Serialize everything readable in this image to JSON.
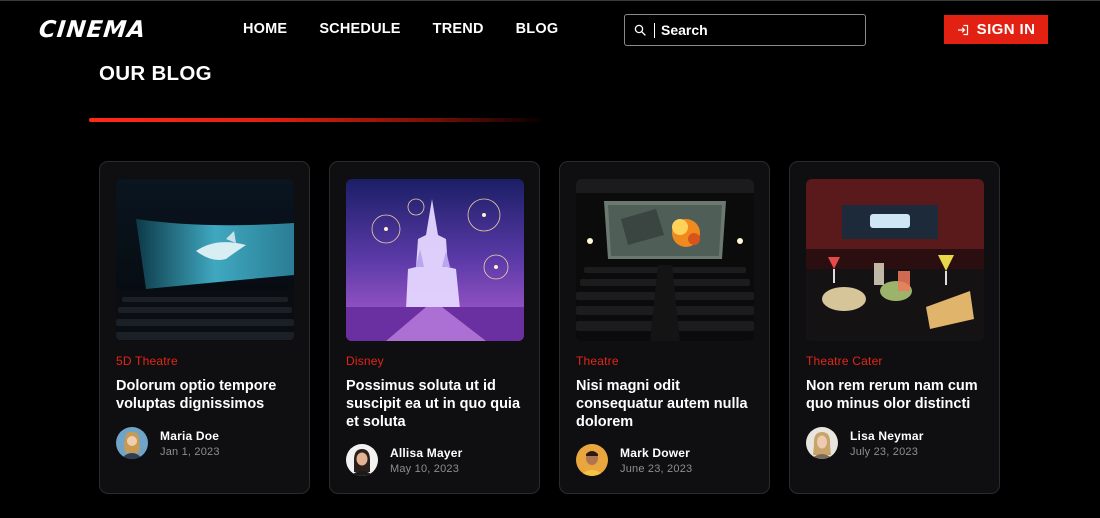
{
  "header": {
    "logo": "CINEMA",
    "nav": [
      "HOME",
      "SCHEDULE",
      "TREND",
      "BLOG"
    ],
    "search_placeholder": "Search",
    "signin_label": "SIGN IN",
    "accent_color": "#e32112"
  },
  "section": {
    "title": "OUR BLOG"
  },
  "posts": [
    {
      "category": "5D Theatre",
      "title": "Dolorum optio tempore voluptas dignissimos",
      "author": "Maria Doe",
      "date": "Jan 1, 2023",
      "image": "shark-theatre-image"
    },
    {
      "category": "Disney",
      "title": "Possimus soluta ut id suscipit ea ut in quo quia et soluta",
      "author": "Allisa Mayer",
      "date": "May 10, 2023",
      "image": "castle-fireworks-image"
    },
    {
      "category": "Theatre",
      "title": "Nisi magni odit consequatur autem nulla dolorem",
      "author": "Mark Dower",
      "date": "June 23, 2023",
      "image": "cinema-hall-image"
    },
    {
      "category": "Theatre Cater",
      "title": "Non rem rerum nam cum quo minus olor distincti",
      "author": "Lisa Neymar",
      "date": "July 23, 2023",
      "image": "dine-in-theatre-image"
    }
  ]
}
